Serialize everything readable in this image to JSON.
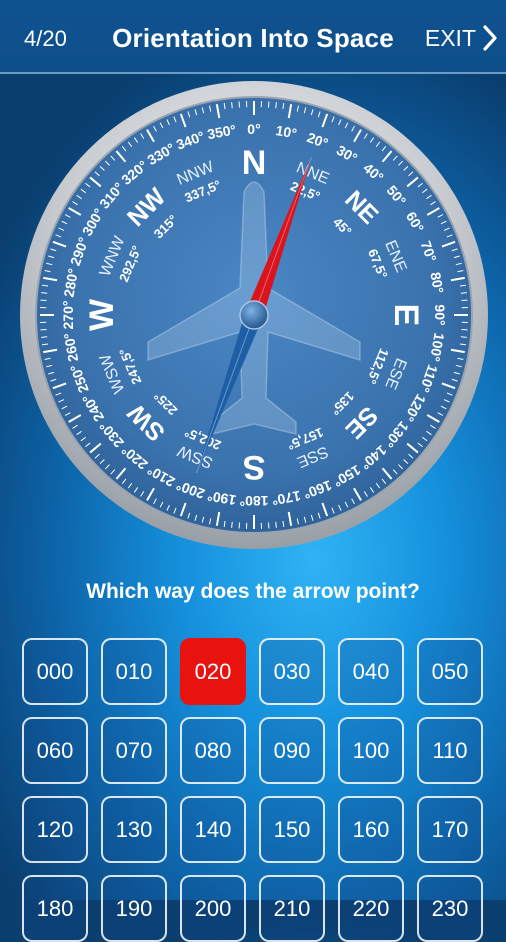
{
  "header": {
    "progress": "4/20",
    "title": "Orientation Into Space",
    "exit_label": "EXIT"
  },
  "compass": {
    "needle_heading_deg": 20,
    "cardinal": [
      "N",
      "E",
      "S",
      "W"
    ],
    "intercardinal": [
      "NE",
      "SE",
      "SW",
      "NW"
    ],
    "intermediate": [
      {
        "label": "NNE",
        "value": "22,5"
      },
      {
        "label": "ENE",
        "value": "67,5"
      },
      {
        "label": "ESE",
        "value": "112,5"
      },
      {
        "label": "SSE",
        "value": "157,5"
      },
      {
        "label": "SSW",
        "value": "202,5"
      },
      {
        "label": "WSW",
        "value": "247,5"
      },
      {
        "label": "WNW",
        "value": "292,5"
      },
      {
        "label": "NNW",
        "value": "337,5"
      }
    ],
    "intercardinal_values": [
      "45",
      "135",
      "225",
      "315"
    ],
    "scale_labels": [
      "0",
      "10",
      "20",
      "30",
      "40",
      "50",
      "60",
      "70",
      "80",
      "90",
      "100",
      "110",
      "120",
      "130",
      "140",
      "150",
      "160",
      "170",
      "180",
      "190",
      "200",
      "210",
      "220",
      "230",
      "240",
      "250",
      "260",
      "270",
      "280",
      "290",
      "300",
      "310",
      "320",
      "330",
      "340",
      "350"
    ],
    "colors": {
      "dial": "#3d78b5",
      "needle_north": "#d9141c",
      "needle_south": "#1d5ea6",
      "bezel": "#c9ccd0"
    }
  },
  "question": "Which way does the arrow point?",
  "headings": [
    "000",
    "010",
    "020",
    "030",
    "040",
    "050",
    "060",
    "070",
    "080",
    "090",
    "100",
    "110",
    "120",
    "130",
    "140",
    "150",
    "160",
    "170",
    "180",
    "190",
    "200",
    "210",
    "220",
    "230"
  ],
  "selected_heading": "020",
  "colors": {
    "selected": "#e8120f"
  }
}
